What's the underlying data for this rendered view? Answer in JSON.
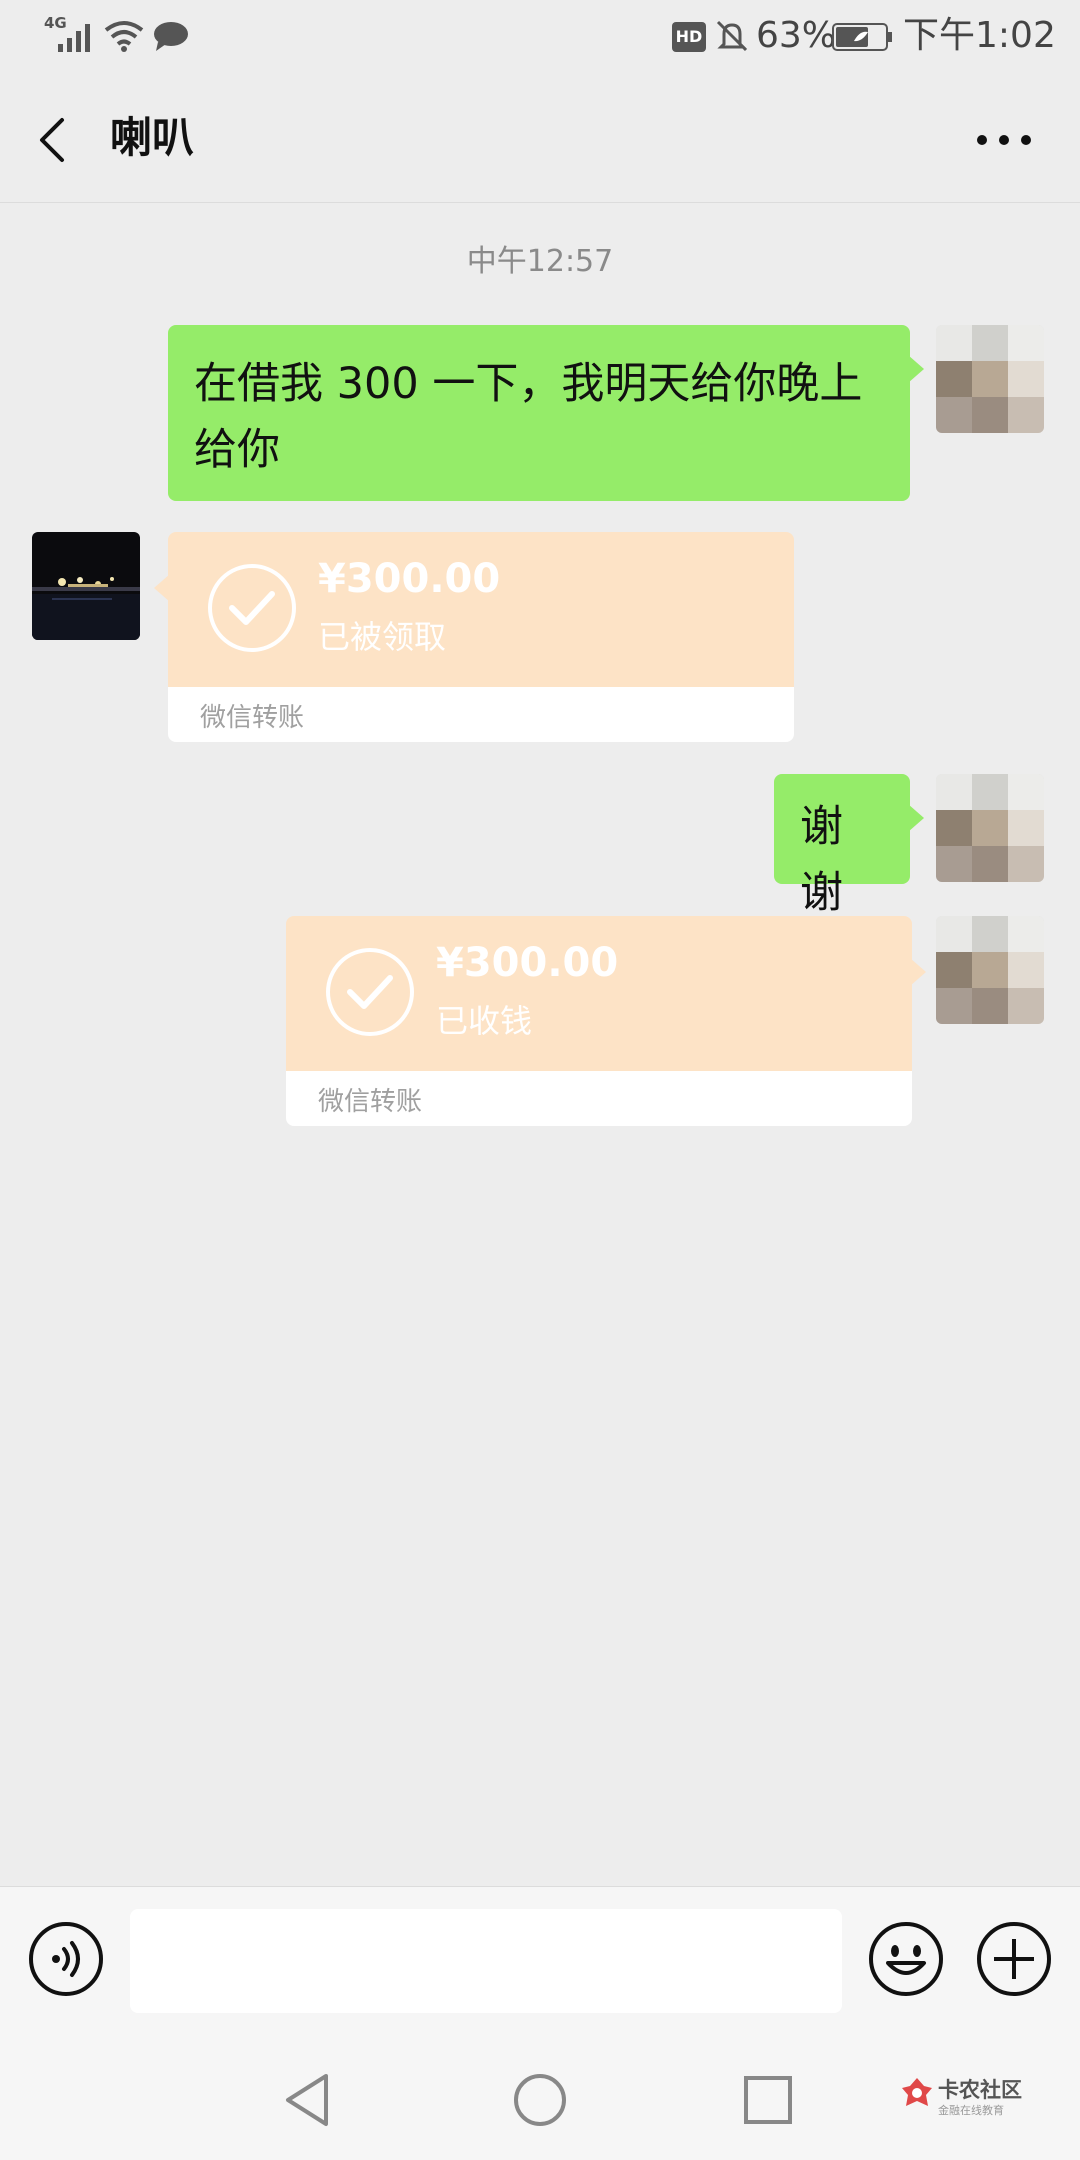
{
  "status_bar": {
    "network": "4G",
    "hd": "HD",
    "battery": "63%",
    "time": "下午1:02"
  },
  "header": {
    "title": "喇叭"
  },
  "chat": {
    "time_separator": "中午12:57",
    "messages": [
      {
        "side": "right",
        "type": "text",
        "text": "在借我 300 一下，我明天给你晚上给你"
      },
      {
        "side": "left",
        "type": "transfer",
        "amount": "¥300.00",
        "status": "已被领取",
        "footer": "微信转账"
      },
      {
        "side": "right",
        "type": "text",
        "text": "谢谢"
      },
      {
        "side": "right",
        "type": "transfer",
        "amount": "¥300.00",
        "status": "已收钱",
        "footer": "微信转账"
      }
    ]
  },
  "watermark": {
    "title": "卡农社区",
    "subtitle": "金融在线教育"
  },
  "colors": {
    "background": "#ededed",
    "sent_bubble": "#95ec69",
    "transfer_card": "#fde3c6"
  }
}
